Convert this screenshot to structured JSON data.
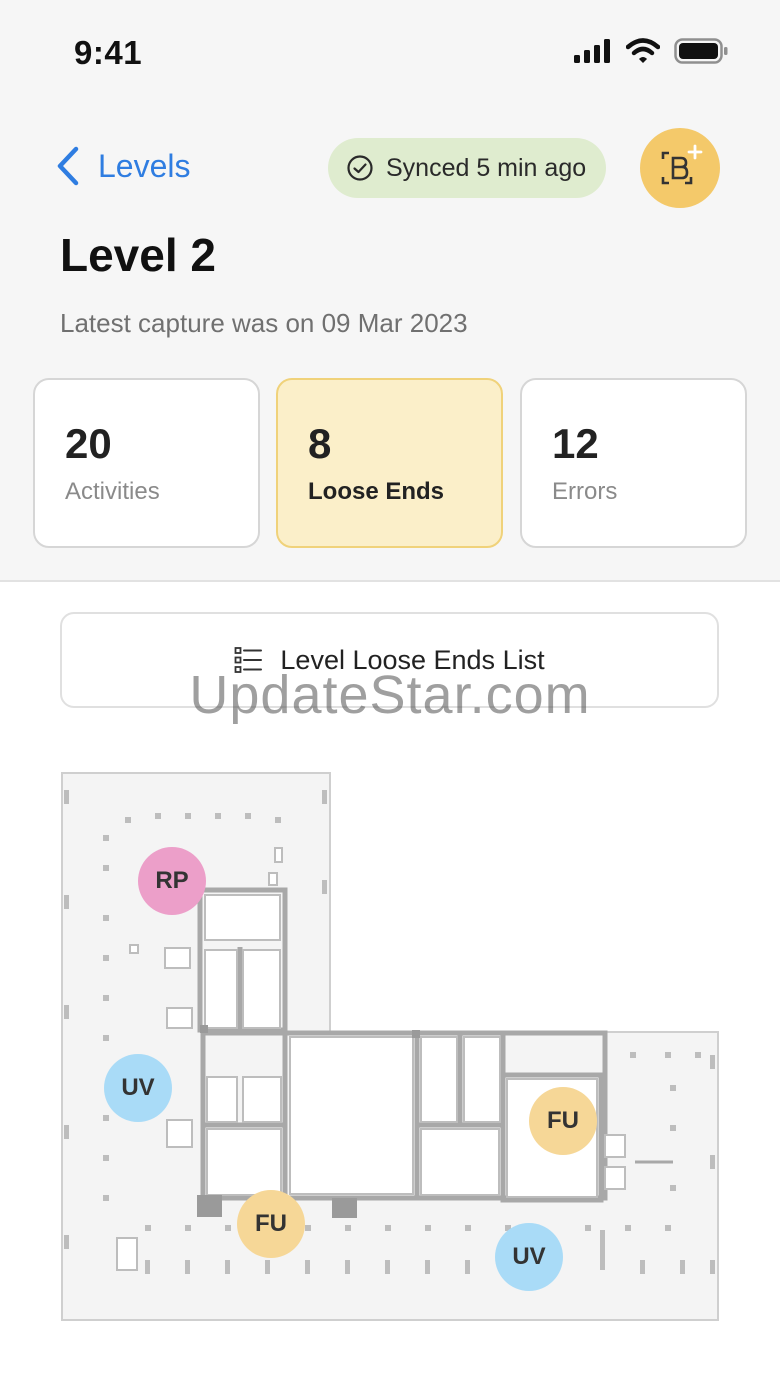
{
  "status_bar": {
    "time": "9:41"
  },
  "nav": {
    "back_label": "Levels",
    "sync_label": "Synced 5 min ago"
  },
  "page": {
    "title": "Level 2",
    "subtitle": "Latest capture was on 09 Mar 2023"
  },
  "stats": [
    {
      "value": "20",
      "label": "Activities"
    },
    {
      "value": "8",
      "label": "Loose Ends"
    },
    {
      "value": "12",
      "label": "Errors"
    }
  ],
  "list_button": {
    "label": "Level Loose Ends List"
  },
  "watermark": "UpdateStar.com",
  "markers": [
    {
      "label": "RP",
      "color": "#ec9fc9"
    },
    {
      "label": "UV",
      "color": "#a9dbf7"
    },
    {
      "label": "FU",
      "color": "#f6d797"
    },
    {
      "label": "FU",
      "color": "#f6d797"
    },
    {
      "label": "UV",
      "color": "#a9dbf7"
    }
  ],
  "colors": {
    "accent": "#2f7de1",
    "sync_bg": "#dfeccf",
    "scan_bg": "#f4c96a",
    "active_card_bg": "#fbefc9"
  },
  "icons": [
    "signal-icon",
    "wifi-icon",
    "battery-icon",
    "chevron-left-icon",
    "check-circle-icon",
    "scan-barcode-add-icon",
    "list-icon"
  ]
}
